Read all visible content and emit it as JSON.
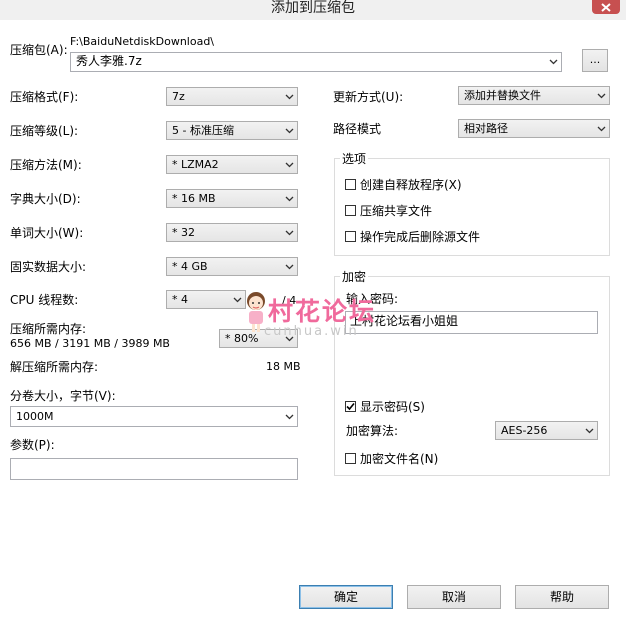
{
  "window": {
    "title": "添加到压缩包"
  },
  "archive": {
    "label": "压缩包(A):",
    "path": "F:\\BaiduNetdiskDownload\\",
    "name": "秀人李雅.7z",
    "browse_label": "..."
  },
  "left": {
    "format": {
      "label": "压缩格式(F):",
      "value": "7z"
    },
    "level": {
      "label": "压缩等级(L):",
      "value": "5 - 标准压缩"
    },
    "method": {
      "label": "压缩方法(M):",
      "value": "* LZMA2"
    },
    "dict": {
      "label": "字典大小(D):",
      "value": "* 16 MB"
    },
    "word": {
      "label": "单词大小(W):",
      "value": "* 32"
    },
    "solid": {
      "label": "固实数据大小:",
      "value": "* 4 GB"
    },
    "cpu": {
      "label": "CPU 线程数:",
      "value": "* 4",
      "total": "/ 4"
    },
    "mem_compress": {
      "label": "压缩所需内存:",
      "detail": "656 MB / 3191 MB / 3989 MB",
      "value": "* 80%"
    },
    "mem_decompress": {
      "label": "解压缩所需内存:",
      "value": "18 MB"
    },
    "volume": {
      "label": "分卷大小，字节(V):",
      "value": "1000M"
    },
    "params": {
      "label": "参数(P):",
      "value": ""
    }
  },
  "right": {
    "update": {
      "label": "更新方式(U):",
      "value": "添加并替换文件"
    },
    "path_mode": {
      "label": "路径模式",
      "value": "相对路径"
    },
    "options": {
      "title": "选项",
      "sfx": {
        "label": "创建自释放程序(X)",
        "checked": false
      },
      "shared": {
        "label": "压缩共享文件",
        "checked": false
      },
      "delete": {
        "label": "操作完成后删除源文件",
        "checked": false
      }
    },
    "encryption": {
      "title": "加密",
      "password_label": "输入密码:",
      "password_value": "上村花论坛看小姐姐",
      "show_password": {
        "label": "显示密码(S)",
        "checked": true
      },
      "algo": {
        "label": "加密算法:",
        "value": "AES-256"
      },
      "encrypt_names": {
        "label": "加密文件名(N)",
        "checked": false
      }
    }
  },
  "buttons": {
    "ok": "确定",
    "cancel": "取消",
    "help": "帮助"
  },
  "watermark": {
    "text": "村花论坛",
    "sub": "cunhua.win"
  }
}
